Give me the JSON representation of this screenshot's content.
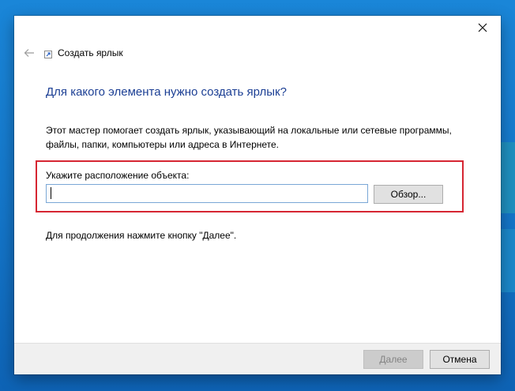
{
  "window": {
    "close_icon": "close-icon",
    "back_icon": "back-arrow-icon"
  },
  "wizard": {
    "title": "Создать ярлык",
    "heading": "Для какого элемента нужно создать ярлык?",
    "description": "Этот мастер помогает создать ярлык, указывающий на локальные или сетевые программы, файлы, папки, компьютеры или адреса в Интернете.",
    "field_label": "Укажите расположение объекта:",
    "location_value": "",
    "browse_label": "Обзор...",
    "continue_hint": "Для продолжения нажмите кнопку \"Далее\"."
  },
  "footer": {
    "next_label": "Далее",
    "cancel_label": "Отмена"
  },
  "colors": {
    "heading": "#1c3f94",
    "highlight": "#d62632",
    "input_border": "#7aa7d6",
    "desktop": "#1475c8"
  }
}
